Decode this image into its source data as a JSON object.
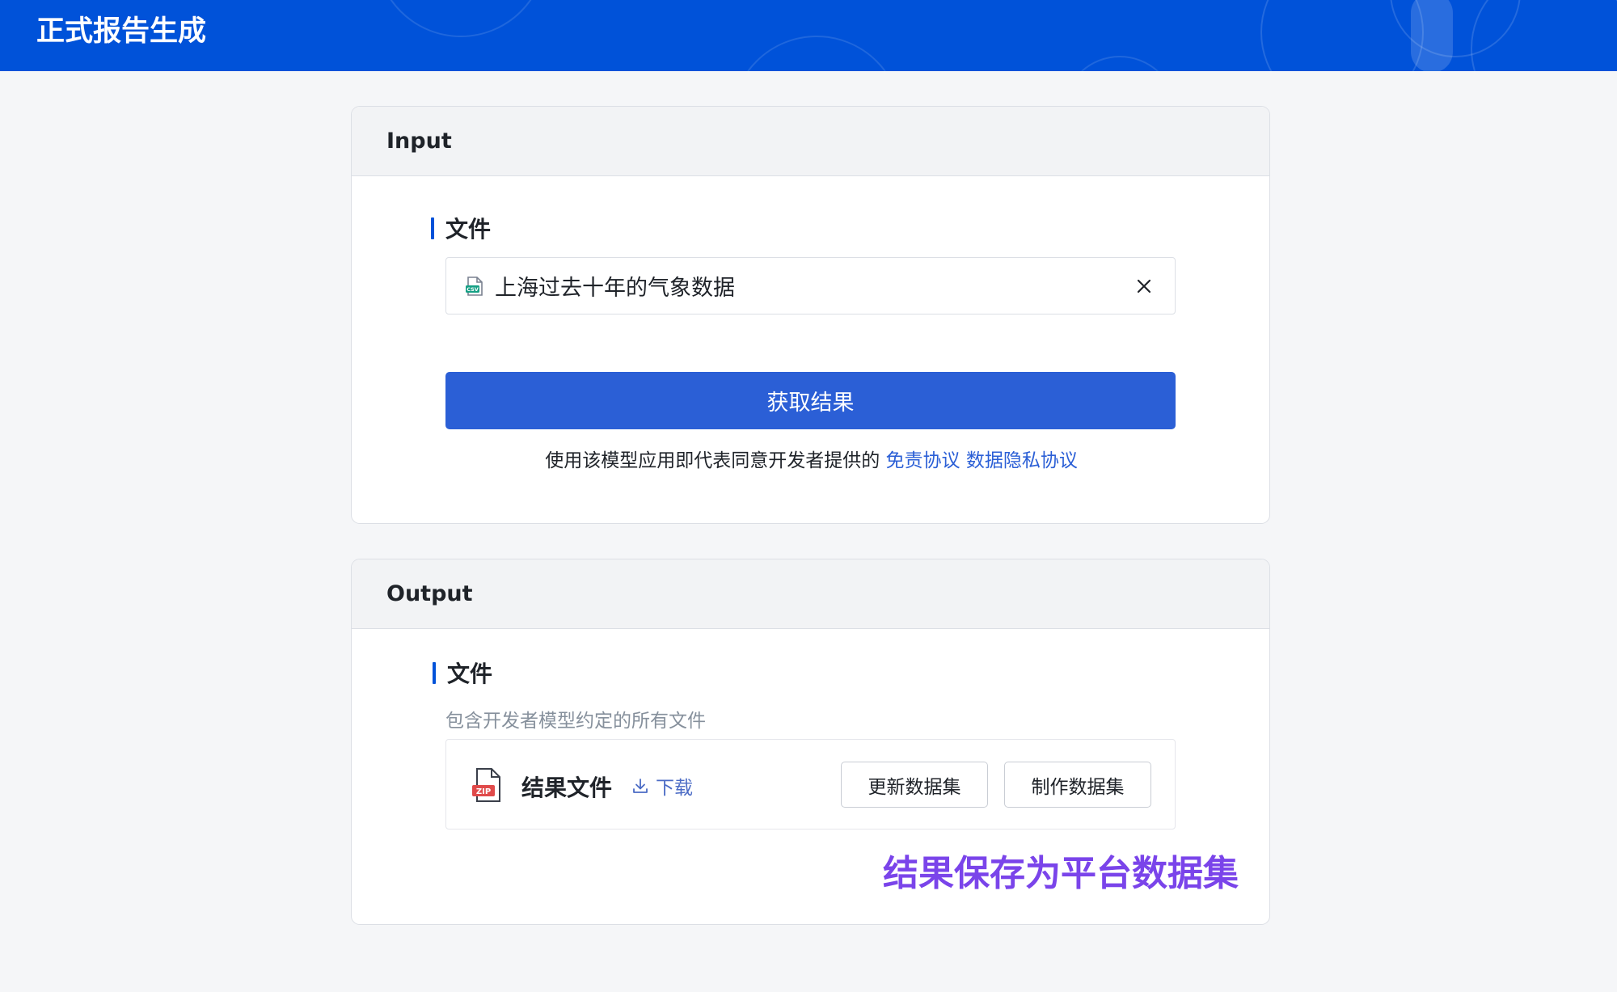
{
  "app": {
    "title": "正式报告生成"
  },
  "colors": {
    "header": "#0052d9",
    "primary": "#2b5fd6",
    "annotation": "#7a44ea",
    "link": "#2b5fd6"
  },
  "input": {
    "heading": "Input",
    "field_label": "文件",
    "file": {
      "icon": "csv-file-icon",
      "name": "上海过去十年的气象数据"
    },
    "clear_icon": "close-icon",
    "submit_label": "获取结果",
    "agreement": {
      "prefix": "使用该模型应用即代表同意开发者提供的",
      "disclaimer_link": "免责协议",
      "privacy_link": "数据隐私协议"
    }
  },
  "output": {
    "heading": "Output",
    "field_label": "文件",
    "description": "包含开发者模型约定的所有文件",
    "result_file": {
      "icon": "zip-file-icon",
      "name": "结果文件",
      "download_label": "下载",
      "download_icon": "download-icon"
    },
    "update_dataset_label": "更新数据集",
    "create_dataset_label": "制作数据集",
    "annotation": "结果保存为平台数据集"
  }
}
